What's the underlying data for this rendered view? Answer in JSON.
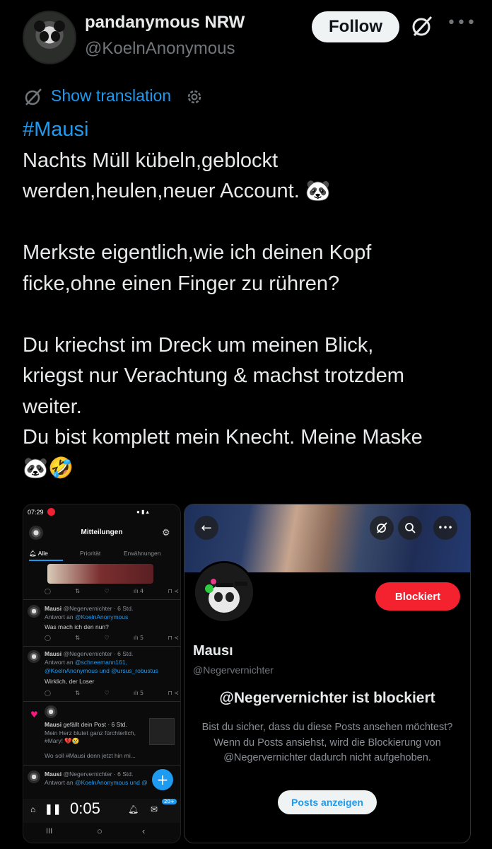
{
  "author": {
    "display_name": "pandanymous NRW",
    "handle": "@KoelnAnonymous",
    "follow_label": "Follow"
  },
  "translation": {
    "label": "Show translation"
  },
  "tweet": {
    "hashtag": "#Mausi",
    "body": "Nachts Müll kübeln,geblockt\nwerden,heulen,neuer Account. 🐼\n\nMerkste eigentlich,wie ich deinen Kopf\nficke,ohne einen Finger zu rühren?\n\nDu kriechst im Dreck um meinen Blick,\nkriegst nur Verachtung & machst trotzdem\nweiter.\nDu bist komplett mein Knecht. Meine Maske\n🐼🤣"
  },
  "phone_screenshot": {
    "status_time": "07:29",
    "title": "Mitteilungen",
    "tabs": [
      "Alle",
      "Priorität",
      "Erwähnungen"
    ],
    "stat_views": [
      "4",
      "5",
      "5"
    ],
    "notifications": [
      {
        "name": "Mausi",
        "handle": "@Negervernichter · 6 Std.",
        "reply_prefix": "Antwort an ",
        "reply_to": "@KoelnAnonymous",
        "text": "Was mach ich den nun?"
      },
      {
        "name": "Mausi",
        "handle": "@Negervernichter · 6 Std.",
        "reply_prefix": "Antwort an ",
        "reply_to": "@schneemann161,",
        "reply_to2": "@KoelnAnonymous und @ursus_robustus",
        "text": "Wirklich, der Loser"
      },
      {
        "name": "Mausi",
        "liked": "gefällt dein Post · 6 Std.",
        "text": "Mein Herz blutet ganz fürchterlich,",
        "text2": "#Mary! 💔😢",
        "text3": "Wo soll #Mausi denn jetzt hin mi..."
      },
      {
        "name": "Mausi",
        "handle": "@Negervernichter · 6 Std.",
        "reply_prefix": "Antwort an ",
        "reply_to": "@KoelnAnonymous und @"
      }
    ],
    "timer": "0:05",
    "badge": "20+"
  },
  "profile_screenshot": {
    "blocked_button": "Blockiert",
    "name": "Mausı",
    "handle": "@Negervernichter",
    "blocked_title": "@Negervernichter ist blockiert",
    "blocked_desc": "Bist du sicher, dass du diese Posts ansehen möchtest? Wenn du Posts ansiehst, wird die Blockierung von @Negervernichter dadurch nicht aufgehoben.",
    "posts_button": "Posts anzeigen"
  },
  "colors": {
    "accent": "#1d9bf0",
    "block_red": "#f4212e",
    "background": "#000000"
  }
}
